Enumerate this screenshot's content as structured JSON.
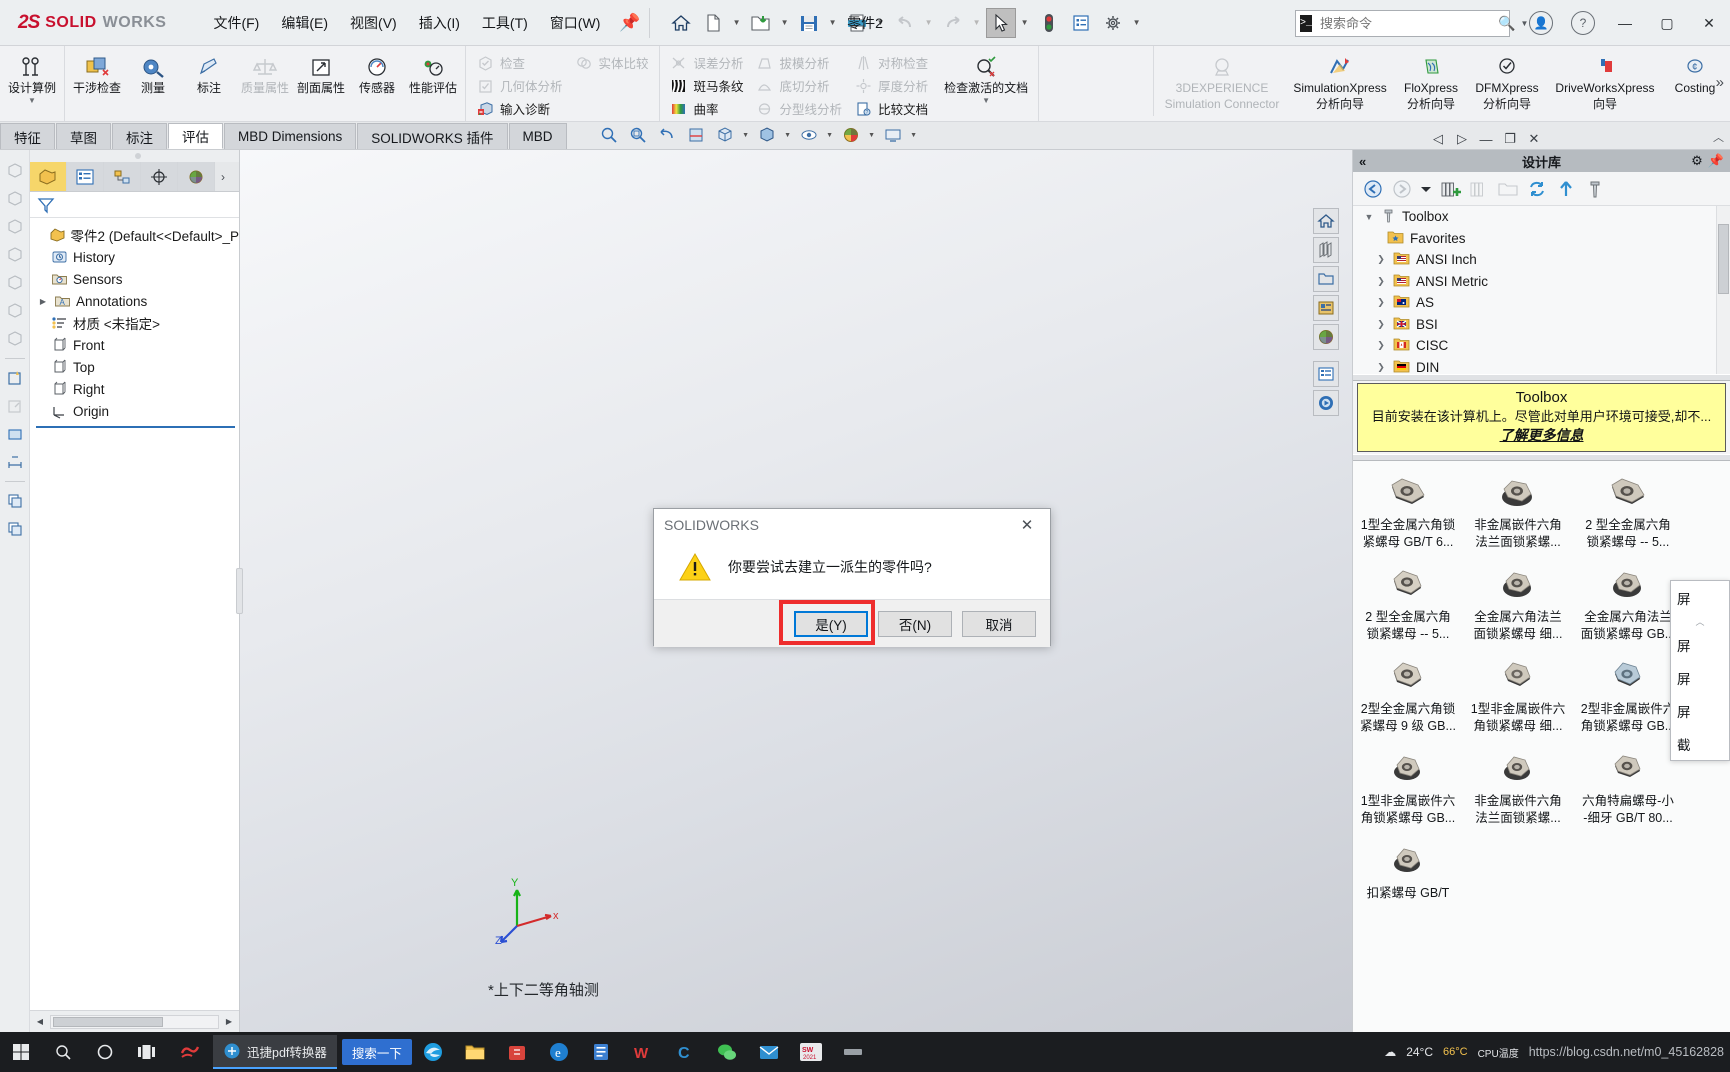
{
  "app": {
    "brand_ds": "2S",
    "brand_solid": "SOLID",
    "brand_works": "WORKS",
    "document_title": "零件2"
  },
  "menu": [
    {
      "label": "文件(F)"
    },
    {
      "label": "编辑(E)"
    },
    {
      "label": "视图(V)"
    },
    {
      "label": "插入(I)"
    },
    {
      "label": "工具(T)"
    },
    {
      "label": "窗口(W)"
    }
  ],
  "quick_access": [
    {
      "name": "home-icon",
      "glyph": "⌂"
    },
    {
      "name": "new-document-icon",
      "glyph": "🗋"
    },
    {
      "name": "open-folder-icon",
      "glyph": "📂"
    },
    {
      "name": "save-icon",
      "glyph": "💾"
    },
    {
      "name": "print-icon",
      "glyph": "🖨"
    },
    {
      "name": "undo-icon",
      "glyph": "↶"
    },
    {
      "name": "redo-icon",
      "glyph": "↷"
    },
    {
      "name": "select-cursor-icon",
      "glyph": "➤"
    },
    {
      "name": "rebuild-icon",
      "glyph": "🚦"
    },
    {
      "name": "file-properties-icon",
      "glyph": "▤"
    },
    {
      "name": "options-gear-icon",
      "glyph": "⚙"
    }
  ],
  "search": {
    "placeholder": "搜索命令",
    "value": ""
  },
  "window_buttons": {
    "account": "account-icon",
    "help": "help-icon",
    "minimize": "—",
    "maximize": "▢",
    "close": "✕"
  },
  "ribbon": {
    "groups": [
      {
        "name": "design-study",
        "items": [
          {
            "label": "设计算例",
            "enabled": true,
            "dropdown": true
          }
        ]
      },
      {
        "name": "evaluate-main",
        "items": [
          {
            "label": "干涉检查",
            "enabled": true
          },
          {
            "label": "测量",
            "enabled": true
          },
          {
            "label": "标注",
            "enabled": true
          },
          {
            "label": "质量属性",
            "enabled": false
          },
          {
            "label": "剖面属性",
            "enabled": true
          },
          {
            "label": "传感器",
            "enabled": true
          },
          {
            "label": "性能评估",
            "enabled": true
          }
        ]
      },
      {
        "name": "check-list",
        "rows": [
          {
            "label": "检查",
            "enabled": false
          },
          {
            "label": "几何体分析",
            "enabled": false
          },
          {
            "label": "输入诊断",
            "enabled": true
          }
        ]
      },
      {
        "name": "compare-list",
        "rows": [
          {
            "label": "实体比较",
            "enabled": false
          }
        ]
      },
      {
        "name": "analysis-list-1",
        "rows": [
          {
            "label": "误差分析",
            "enabled": false
          },
          {
            "label": "斑马条纹",
            "enabled": true
          },
          {
            "label": "曲率",
            "enabled": true
          }
        ]
      },
      {
        "name": "analysis-list-2",
        "rows": [
          {
            "label": "拔模分析",
            "enabled": false
          },
          {
            "label": "底切分析",
            "enabled": false
          },
          {
            "label": "分型线分析",
            "enabled": false
          }
        ]
      },
      {
        "name": "analysis-list-3",
        "rows": [
          {
            "label": "对称检查",
            "enabled": false
          },
          {
            "label": "厚度分析",
            "enabled": false
          },
          {
            "label": "比较文档",
            "enabled": true
          }
        ]
      },
      {
        "name": "check-active-doc",
        "items": [
          {
            "label": "检查激活的文档",
            "enabled": true,
            "dropdown": true
          }
        ]
      }
    ],
    "xpress": [
      {
        "name": "3dexperience",
        "line1": "3DEXPERIENCE",
        "line2": "Simulation Connector",
        "enabled": false
      },
      {
        "name": "simulationxpress",
        "line1": "SimulationXpress",
        "line2": "分析向导",
        "enabled": true
      },
      {
        "name": "floxpress",
        "line1": "FloXpress",
        "line2": "分析向导",
        "enabled": true
      },
      {
        "name": "dfmxpress",
        "line1": "DFMXpress",
        "line2": "分析向导",
        "enabled": true
      },
      {
        "name": "driveworksxpress",
        "line1": "DriveWorksXpress",
        "line2": "向导",
        "enabled": true
      },
      {
        "name": "costing",
        "line1": "Costing",
        "line2": "",
        "enabled": true
      }
    ]
  },
  "command_tabs": [
    {
      "label": "特征",
      "active": false
    },
    {
      "label": "草图",
      "active": false
    },
    {
      "label": "标注",
      "active": false
    },
    {
      "label": "评估",
      "active": true
    },
    {
      "label": "MBD Dimensions",
      "active": false
    },
    {
      "label": "SOLIDWORKS 插件",
      "active": false
    },
    {
      "label": "MBD",
      "active": false
    }
  ],
  "view_toolbar": [
    {
      "name": "zoom-to-fit-icon",
      "glyph": "⌕"
    },
    {
      "name": "zoom-to-area-icon",
      "glyph": "⌕"
    },
    {
      "name": "previous-view-icon",
      "glyph": "↺"
    },
    {
      "name": "section-view-icon",
      "glyph": "▤"
    },
    {
      "name": "view-orientation-icon",
      "glyph": "◧"
    },
    {
      "name": "display-style-icon",
      "glyph": "▣"
    },
    {
      "name": "hide-show-items-icon",
      "glyph": "👁"
    },
    {
      "name": "appearance-icon",
      "glyph": "🎨"
    },
    {
      "name": "scene-icon",
      "glyph": "🖥"
    }
  ],
  "feature_manager": {
    "tabs": [
      {
        "name": "feature-tree-tab",
        "active": true
      },
      {
        "name": "property-manager-tab",
        "active": false
      },
      {
        "name": "configuration-manager-tab",
        "active": false
      },
      {
        "name": "dimxpert-manager-tab",
        "active": false
      },
      {
        "name": "display-manager-tab",
        "active": false
      }
    ],
    "more_tabs_glyph": "›",
    "filter_placeholder": "",
    "tree": [
      {
        "label": "零件2  (Default<<Default>_P",
        "icon": "part-icon",
        "indent": 0,
        "expandable": false
      },
      {
        "label": "History",
        "icon": "history-icon",
        "indent": 1,
        "expandable": false
      },
      {
        "label": "Sensors",
        "icon": "sensors-icon",
        "indent": 1,
        "expandable": false
      },
      {
        "label": "Annotations",
        "icon": "annotations-icon",
        "indent": 1,
        "expandable": true
      },
      {
        "label": "材质 <未指定>",
        "icon": "material-icon",
        "indent": 1,
        "expandable": false
      },
      {
        "label": "Front",
        "icon": "plane-icon",
        "indent": 1,
        "expandable": false
      },
      {
        "label": "Top",
        "icon": "plane-icon",
        "indent": 1,
        "expandable": false
      },
      {
        "label": "Right",
        "icon": "plane-icon",
        "indent": 1,
        "expandable": false
      },
      {
        "label": "Origin",
        "icon": "origin-icon",
        "indent": 1,
        "expandable": false
      }
    ]
  },
  "graphics": {
    "view_label": "*上下二等角轴测",
    "triad": {
      "x": "x",
      "y": "Y",
      "z": "Z"
    }
  },
  "dialog": {
    "title": "SOLIDWORKS",
    "close_glyph": "✕",
    "message": "你要尝试去建立一派生的零件吗?",
    "buttons": [
      {
        "label": "是(Y)",
        "default": true,
        "highlighted": true
      },
      {
        "label": "否(N)",
        "default": false,
        "highlighted": false
      },
      {
        "label": "取消",
        "default": false,
        "highlighted": false
      }
    ],
    "highlight_color": "#ee2d2d",
    "focus_color": "#0078d7"
  },
  "design_library": {
    "title": "设计库",
    "collapse_glyph": "«",
    "header_actions": [
      {
        "name": "settings-gear-icon",
        "glyph": "⚙"
      },
      {
        "name": "pin-icon",
        "glyph": "📌"
      }
    ],
    "toolbar": [
      {
        "name": "back-icon",
        "glyph": "←"
      },
      {
        "name": "forward-icon",
        "glyph": "→"
      },
      {
        "name": "history-dropdown-icon",
        "glyph": "▾"
      },
      {
        "name": "add-to-library-icon",
        "glyph": "📚"
      },
      {
        "name": "add-file-location-icon",
        "glyph": "📚"
      },
      {
        "name": "create-folder-icon",
        "glyph": "📁"
      },
      {
        "name": "refresh-icon",
        "glyph": "🔄"
      },
      {
        "name": "up-one-level-icon",
        "glyph": "⬆"
      },
      {
        "name": "toolbox-icon",
        "glyph": "🔩"
      }
    ],
    "tree": [
      {
        "label": "Toolbox",
        "indent": 0,
        "chevron": "v",
        "icon": "bolt-icon"
      },
      {
        "label": "Favorites",
        "indent": 1,
        "chevron": "",
        "icon": "favorites-folder-icon"
      },
      {
        "label": "ANSI Inch",
        "indent": 1,
        "chevron": ">",
        "icon": "flag-us-icon"
      },
      {
        "label": "ANSI Metric",
        "indent": 1,
        "chevron": ">",
        "icon": "flag-us-icon"
      },
      {
        "label": "AS",
        "indent": 1,
        "chevron": ">",
        "icon": "flag-au-icon"
      },
      {
        "label": "BSI",
        "indent": 1,
        "chevron": ">",
        "icon": "flag-uk-icon"
      },
      {
        "label": "CISC",
        "indent": 1,
        "chevron": ">",
        "icon": "flag-ca-icon"
      },
      {
        "label": "DIN",
        "indent": 1,
        "chevron": ">",
        "icon": "flag-de-icon"
      }
    ],
    "note": {
      "title": "Toolbox",
      "body": "目前安装在该计算机上。尽管此对单用户环境可接受,却不...",
      "link": "了解更多信息"
    },
    "items": [
      {
        "caption": "1型全金属六角锁\n紧螺母 GB/T 6...",
        "icon": "hexnut-icon"
      },
      {
        "caption": "非金属嵌件六角\n法兰面锁紧螺...",
        "icon": "flangenut-icon"
      },
      {
        "caption": "2 型全金属六角\n锁紧螺母 -- 5...",
        "icon": "hexnut-icon"
      },
      {
        "caption": "2 型全金属六角\n锁紧螺母 -- 5...",
        "icon": "hexnut-icon"
      },
      {
        "caption": "全金属六角法兰\n面锁紧螺母 细...",
        "icon": "flangenut-icon"
      },
      {
        "caption": "全金属六角法兰\n面锁紧螺母 GB...",
        "icon": "flangenut-icon"
      },
      {
        "caption": "2型全金属六角锁\n紧螺母 9 级 GB...",
        "icon": "hexnut-icon"
      },
      {
        "caption": "1型非金属嵌件六\n角锁紧螺母 细...",
        "icon": "hexnut-icon"
      },
      {
        "caption": "2型非金属嵌件六\n角锁紧螺母 GB...",
        "icon": "bluenut-icon"
      },
      {
        "caption": "1型非金属嵌件六\n角锁紧螺母 GB...",
        "icon": "flangenut-icon"
      },
      {
        "caption": "非金属嵌件六角\n法兰面锁紧螺...",
        "icon": "flangenut-icon"
      },
      {
        "caption": "六角特扁螺母-小\n-细牙 GB/T 80...",
        "icon": "hexnut-icon"
      },
      {
        "caption": "扣紧螺母 GB/T",
        "icon": "flangenut-icon"
      }
    ]
  },
  "flyout_menu": {
    "items": [
      "屏",
      "屏",
      "屏",
      "屏",
      "截"
    ],
    "scroll_glyph": "︿"
  },
  "taskbar": {
    "start_glyph": "⊞",
    "search_glyph": "🔍",
    "cortana_glyph": "◯",
    "taskview_glyph": "❐",
    "apps": [
      {
        "name": "solidworks-taskbar-icon",
        "label": "",
        "active": false
      },
      {
        "name": "pdf-converter-app",
        "label": "迅捷pdf转换器",
        "active": true
      },
      {
        "name": "search-pill",
        "label": "搜索一下",
        "active": false
      },
      {
        "name": "edge-browser-icon",
        "label": "",
        "active": false
      },
      {
        "name": "file-explorer-icon",
        "label": "",
        "active": false
      },
      {
        "name": "store-icon",
        "label": "",
        "active": false
      },
      {
        "name": "ie-browser-icon",
        "label": "",
        "active": false
      },
      {
        "name": "note-app-icon",
        "label": "",
        "active": false
      },
      {
        "name": "wps-icon",
        "label": "",
        "active": false
      },
      {
        "name": "c-app-icon",
        "label": "",
        "active": false
      },
      {
        "name": "wechat-icon",
        "label": "",
        "active": false
      },
      {
        "name": "mail-icon",
        "label": "",
        "active": false
      },
      {
        "name": "solidworks-2021-icon",
        "label": "",
        "active": false
      },
      {
        "name": "misc-app-icon",
        "label": "",
        "active": false
      }
    ],
    "tray": {
      "weather_icon": "☁",
      "temperature": "24°C",
      "cpu_label": "66°C",
      "cpu_sub": "CPU温度",
      "watermark": "https://blog.csdn.net/m0_45162828"
    }
  }
}
